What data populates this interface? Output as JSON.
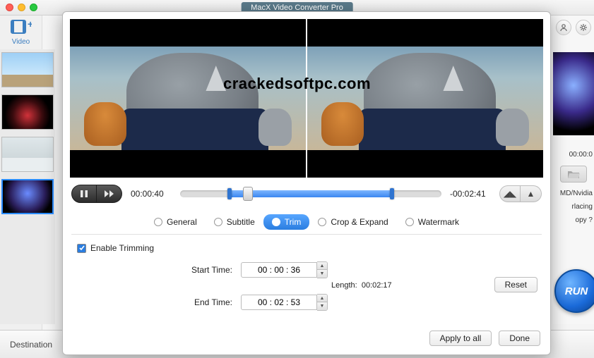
{
  "window": {
    "title": "MacX Video Converter Pro"
  },
  "watermark": "crackedsoftpc.com",
  "toolbar": {
    "video_label": "Video"
  },
  "playback": {
    "current_time": "00:00:40",
    "remaining_time": "-00:02:41"
  },
  "tabs": {
    "general": "General",
    "subtitle": "Subtitle",
    "trim": "Trim",
    "crop": "Crop & Expand",
    "watermark": "Watermark"
  },
  "trim": {
    "enable_label": "Enable Trimming",
    "enabled": true,
    "start_label": "Start Time:",
    "start_value": "00 : 00 : 36",
    "end_label": "End Time:",
    "end_value": "00 : 02 : 53",
    "length_label": "Length:",
    "length_value": "00:02:17",
    "reset_label": "Reset"
  },
  "footer": {
    "apply_all": "Apply to all",
    "done": "Done"
  },
  "destination": {
    "label": "Destination"
  },
  "right": {
    "timecode": "00:00:0",
    "opt1": "MD/Nvidia",
    "opt2": "rlacing",
    "opt3": "opy ?",
    "run": "RUN"
  },
  "colors": {
    "accent": "#2a7de0"
  }
}
